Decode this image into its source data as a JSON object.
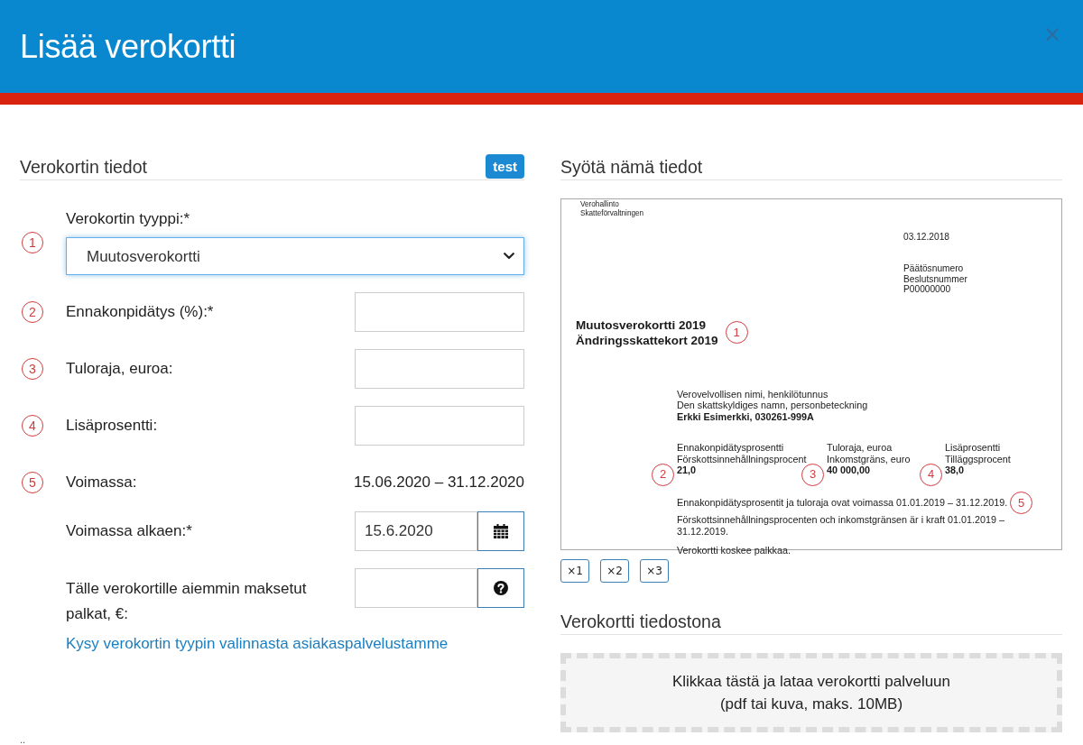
{
  "dialog": {
    "title": "Lisää verokortti",
    "close_label": "×"
  },
  "form": {
    "heading": "Verokortin tiedot",
    "badge": "test",
    "fields": [
      {
        "kind": "select",
        "number": "1",
        "label": "Verokortin tyyppi:*",
        "value": "Muutosverokortti",
        "focused": true
      },
      {
        "kind": "input",
        "number": "2",
        "label": "Ennakonpidätys (%):*",
        "focused": false
      },
      {
        "kind": "input",
        "number": "3",
        "label": "Tuloraja, euroa:",
        "focused": false
      },
      {
        "kind": "input",
        "number": "4",
        "label": "Lisäprosentti:",
        "focused": false
      },
      {
        "kind": "text",
        "number": "5",
        "label": "Voimassa:",
        "value": "15.06.2020 – 31.12.2020"
      },
      {
        "kind": "date",
        "label": "Voimassa alkaen:*",
        "value": "15.6.2020",
        "focused": false
      },
      {
        "kind": "help",
        "label": "Tälle verokortille aiemmin maksetut palkat, €:",
        "focused": false
      }
    ],
    "help_link": "Kysy verokortin tyypin valinnasta asiakaspalvelustamme"
  },
  "preview": {
    "heading": "Syötä nämä tiedot",
    "document": {
      "issuer": [
        "Verohallinto",
        "Skatteförvaltningen"
      ],
      "date": "03.12.2018",
      "decision": [
        "Päätösnumero",
        "Beslutsnummer",
        "P00000000"
      ],
      "title": [
        "Muutosverokortti 2019",
        "Ändringsskattekort 2019"
      ],
      "title_marker": "1",
      "taxpayer": {
        "labels": [
          "Verovelvollisen nimi, henkilötunnus",
          "Den skattskyldiges namn, personbeteckning"
        ],
        "value": "Erkki Esimerkki, 030261-999A"
      },
      "figures": [
        {
          "labels": [
            "Ennakonpidätysprosentti",
            "Förskottsinnehållningsprocent"
          ],
          "value": "21,0",
          "marker": "2"
        },
        {
          "labels": [
            "Tuloraja, euroa",
            "Inkomstgräns, euro"
          ],
          "value": "40 000,00",
          "marker": "3"
        },
        {
          "labels": [
            "Lisäprosentti",
            "Tilläggsprocent"
          ],
          "value": "38,0",
          "marker": "4"
        }
      ],
      "validity": [
        {
          "text": "Ennakonpidätysprosentit ja tuloraja ovat voimassa 01.01.2019 – 31.12.2019.",
          "marker": "5"
        },
        {
          "text": "Förskottsinnehållningsprocenten och inkomstgränsen är i kraft 01.01.2019 – 31.12.2019."
        }
      ],
      "note": "Verokortti koskee palkkaa."
    },
    "zoom_buttons": [
      {
        "label": "×1"
      },
      {
        "label": "×2"
      },
      {
        "label": "×3"
      }
    ]
  },
  "upload": {
    "heading": "Verokortti tiedostona",
    "lines": [
      "Klikkaa tästä ja lataa verokortti palveluun",
      "(pdf tai kuva, maks. 10MB)"
    ]
  },
  "footer_fragment": ".."
}
